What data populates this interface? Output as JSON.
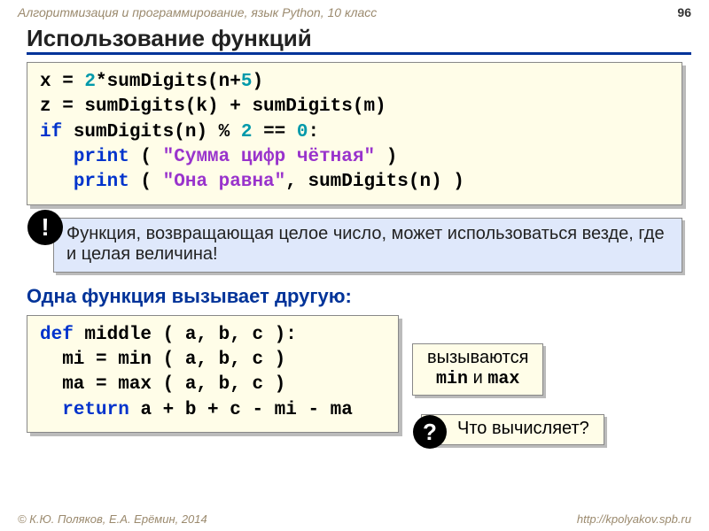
{
  "header": {
    "course": "Алгоритмизация и программирование, язык Python, 10 класс",
    "page": "96"
  },
  "title": "Использование функций",
  "code1": {
    "l1": {
      "a": "x = ",
      "b": "2",
      "c": "*sumDigits(n+",
      "d": "5",
      "e": ")"
    },
    "l2": "z = sumDigits(k) + sumDigits(m)",
    "l3": {
      "a": "if",
      "b": " sumDigits(n)",
      "c": " % ",
      "d": "2",
      "e": " == ",
      "f": "0",
      "g": ":"
    },
    "l4": {
      "a": "   ",
      "b": "print",
      "c": " ( ",
      "d": "\"Сумма цифр чётная\"",
      "e": " )"
    },
    "l5": {
      "a": "   ",
      "b": "print",
      "c": " ( ",
      "d": "\"Она равна\"",
      "e": ", sumDigits(n) )"
    }
  },
  "callout": {
    "bang": "!",
    "text": "Функция, возвращающая целое число, может использоваться везде, где и целая величина!"
  },
  "subhead": "Одна функция вызывает другую:",
  "code2": {
    "l1": {
      "a": "def",
      "b": " middle ( a, b, c ):"
    },
    "l2": "  mi = min ( a, b, c )",
    "l3": "  ma = max ( a, b, c )",
    "l4": {
      "a": "  ",
      "b": "return",
      "c": " a + b + c - mi - ma"
    }
  },
  "inset": {
    "t1": "вызываются",
    "t2a": "min",
    "t2b": " и ",
    "t2c": "max"
  },
  "question": {
    "q": "?",
    "text": "Что вычисляет?"
  },
  "footer": {
    "left": "© К.Ю. Поляков, Е.А. Ерёмин, 2014",
    "right": "http://kpolyakov.spb.ru"
  }
}
